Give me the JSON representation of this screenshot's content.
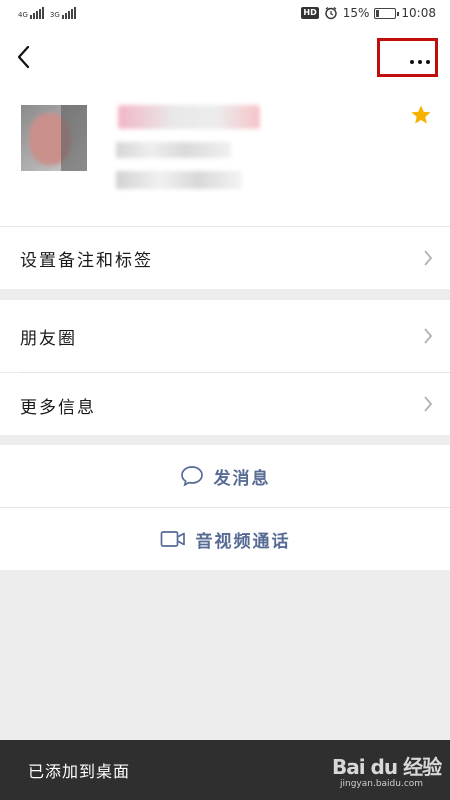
{
  "status_bar": {
    "network1": "4G",
    "network2": "3G",
    "hd": "HD",
    "battery_percent": "15%",
    "battery_level": 0.15,
    "time": "10:08"
  },
  "nav": {
    "back_icon": "chevron-left-icon",
    "more_icon": "more-dots-icon",
    "highlight_color": "#c30d0d"
  },
  "profile": {
    "star_color": "#f5b300"
  },
  "menu": {
    "set_remark": "设置备注和标签",
    "moments": "朋友圈",
    "more_info": "更多信息"
  },
  "actions": {
    "send_message": "发消息",
    "video_call": "音视频通话",
    "accent_color": "#576b95"
  },
  "toast": {
    "text": "已添加到桌面"
  },
  "watermark": {
    "text": "Bai du 经验",
    "sub": "jingyan.baidu.com"
  }
}
